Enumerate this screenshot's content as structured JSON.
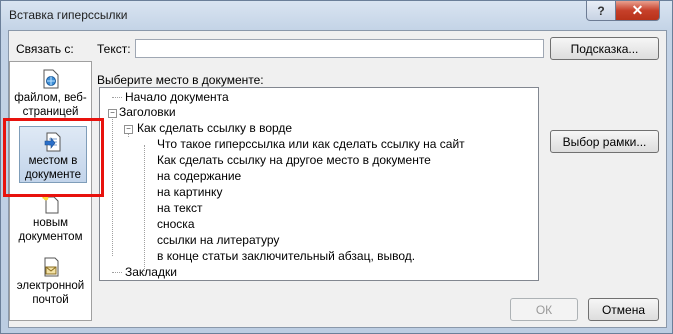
{
  "window": {
    "title": "Вставка гиперссылки",
    "help_label": "?",
    "close_label": "✕"
  },
  "link_to": {
    "label": "Связать с:",
    "items": [
      {
        "label": "файлом, веб-страницей",
        "icon": "file-web-page-icon",
        "selected": false
      },
      {
        "label": "местом в документе",
        "icon": "place-in-document-icon",
        "selected": true
      },
      {
        "label": "новым документом",
        "icon": "new-document-icon",
        "selected": false
      },
      {
        "label": "электронной почтой",
        "icon": "email-icon",
        "selected": false
      }
    ]
  },
  "text_field": {
    "label": "Текст:",
    "value": ""
  },
  "buttons": {
    "tooltip": "Подсказка...",
    "frame": "Выбор рамки...",
    "ok": "ОК",
    "cancel": "Отмена"
  },
  "place": {
    "label": "Выберите место в документе:",
    "tree": {
      "top": "Начало документа",
      "headings": "Заголовки",
      "heading_main": "Как сделать ссылку в ворде",
      "subheadings": [
        "Что такое гиперссылка или как сделать ссылку на сайт",
        "Как сделать ссылку на другое место в документе",
        "на содержание",
        "на картинку",
        "на текст",
        "сноска",
        "ссылки на литературу",
        "в конце статьи заключительный абзац, вывод."
      ],
      "bookmarks": "Закладки"
    }
  },
  "colors": {
    "highlight": "#e8120d",
    "selection": "#c2d4ea"
  }
}
